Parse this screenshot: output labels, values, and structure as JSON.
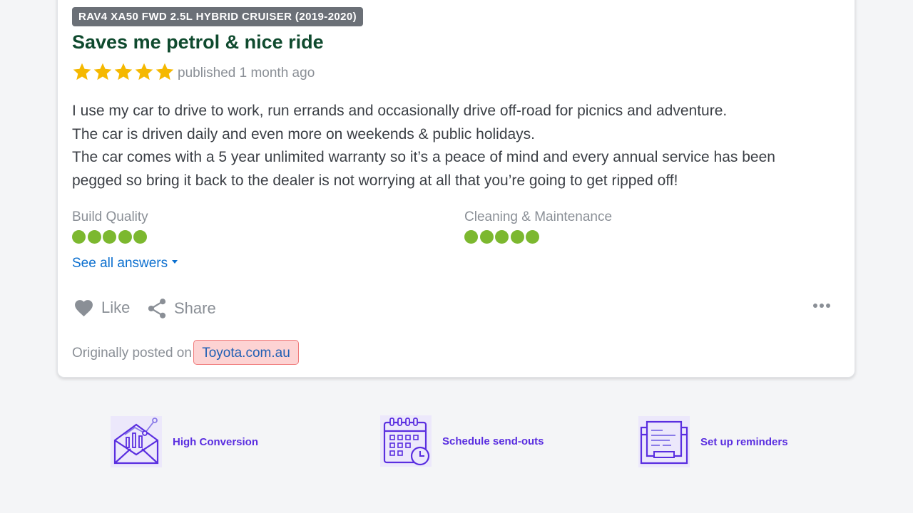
{
  "review": {
    "variant_badge": "RAV4 XA50 FWD 2.5L HYBRID CRUISER (2019-2020)",
    "title": "Saves me petrol & nice ride",
    "rating": 5,
    "published": "published 1 month ago",
    "body_lines": [
      "I use my car to drive to work, run errands and occasionally drive off-road for picnics and adventure.",
      "The car is driven daily and even more on weekends & public holidays.",
      "The car comes with a 5 year unlimited warranty so it’s a peace of mind and every annual service has been",
      "pegged so bring it back to the dealer is not worrying at all that you’re going to get ripped off!"
    ],
    "metrics": [
      {
        "label": "Build Quality",
        "score": 5,
        "max": 5
      },
      {
        "label": "Cleaning & Maintenance",
        "score": 5,
        "max": 5
      }
    ],
    "see_all_label": "See all answers",
    "actions": {
      "like_label": "Like",
      "share_label": "Share",
      "more_icon": "ellipsis-icon"
    },
    "origin_prefix": "Originally posted on",
    "origin_link": "Toyota.com.au"
  },
  "features": [
    {
      "label": "High Conversion",
      "icon": "envelope-chart-icon"
    },
    {
      "label": "Schedule send-outs",
      "icon": "calendar-clock-icon"
    },
    {
      "label": "Set up reminders",
      "icon": "printer-document-icon"
    }
  ],
  "colors": {
    "title": "#0f4a2e",
    "star": "#f5b800",
    "rating_dot": "#7cb82f",
    "link": "#0b6fcf",
    "feature_accent": "#5a2ee0",
    "highlight_bg": "#fdd3d3",
    "highlight_border": "#f07a7a"
  }
}
